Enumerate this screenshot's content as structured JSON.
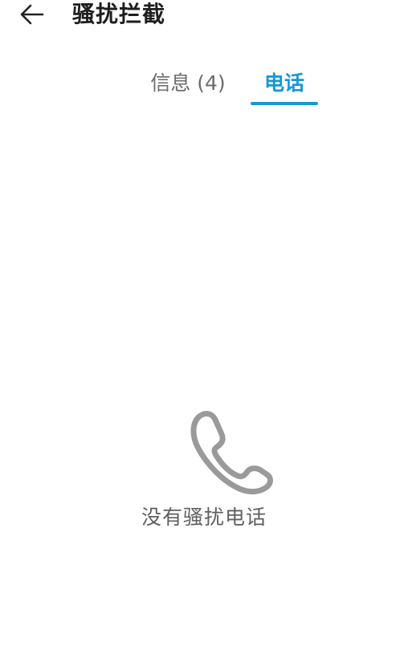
{
  "header": {
    "back_icon": "arrow-left-icon",
    "title": "骚扰拦截"
  },
  "tabs": [
    {
      "label": "信息 (4)",
      "selected": false
    },
    {
      "label": "电话",
      "selected": true
    }
  ],
  "colors": {
    "accent": "#1598d8",
    "inactive_tab": "#6b6b6b",
    "icon_gray": "#9a9a9a"
  },
  "empty_state": {
    "icon": "phone-icon",
    "text": "没有骚扰电话"
  }
}
